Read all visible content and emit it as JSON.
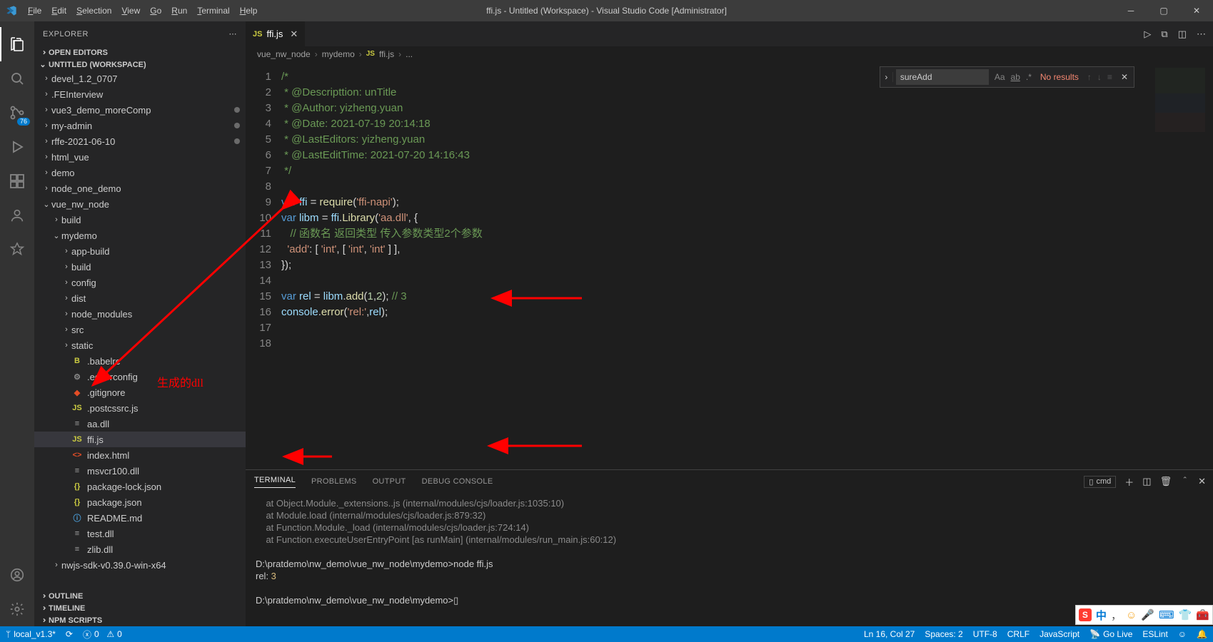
{
  "window": {
    "title": "ffi.js - Untitled (Workspace) - Visual Studio Code [Administrator]"
  },
  "menu": {
    "items": [
      "File",
      "Edit",
      "Selection",
      "View",
      "Go",
      "Run",
      "Terminal",
      "Help"
    ]
  },
  "activitybar": {
    "badge_scm": "76"
  },
  "sidebar": {
    "title": "EXPLORER",
    "sections": {
      "open_editors": "OPEN EDITORS",
      "workspace": "UNTITLED (WORKSPACE)",
      "outline": "OUTLINE",
      "timeline": "TIMELINE",
      "npm": "NPM SCRIPTS"
    },
    "tree": [
      {
        "depth": 0,
        "kind": "folder",
        "open": false,
        "name": "devel_1.2_0707",
        "dot": false
      },
      {
        "depth": 0,
        "kind": "folder",
        "open": false,
        "name": ".FEInterview",
        "dot": false
      },
      {
        "depth": 0,
        "kind": "folder",
        "open": false,
        "name": "vue3_demo_moreComp",
        "dot": true
      },
      {
        "depth": 0,
        "kind": "folder",
        "open": false,
        "name": "my-admin",
        "dot": true
      },
      {
        "depth": 0,
        "kind": "folder",
        "open": false,
        "name": "rffe-2021-06-10",
        "dot": true
      },
      {
        "depth": 0,
        "kind": "folder",
        "open": false,
        "name": "html_vue",
        "dot": false
      },
      {
        "depth": 0,
        "kind": "folder",
        "open": false,
        "name": "demo",
        "dot": false
      },
      {
        "depth": 0,
        "kind": "folder",
        "open": false,
        "name": "node_one_demo",
        "dot": false
      },
      {
        "depth": 0,
        "kind": "folder",
        "open": true,
        "name": "vue_nw_node",
        "dot": false
      },
      {
        "depth": 1,
        "kind": "folder",
        "open": false,
        "name": "build",
        "dot": false
      },
      {
        "depth": 1,
        "kind": "folder",
        "open": true,
        "name": "mydemo",
        "dot": false
      },
      {
        "depth": 2,
        "kind": "folder",
        "open": false,
        "name": "app-build",
        "dot": false
      },
      {
        "depth": 2,
        "kind": "folder",
        "open": false,
        "name": "build",
        "dot": false
      },
      {
        "depth": 2,
        "kind": "folder",
        "open": false,
        "name": "config",
        "dot": false
      },
      {
        "depth": 2,
        "kind": "folder",
        "open": false,
        "name": "dist",
        "dot": false
      },
      {
        "depth": 2,
        "kind": "folder",
        "open": false,
        "name": "node_modules",
        "dot": false
      },
      {
        "depth": 2,
        "kind": "folder",
        "open": false,
        "name": "src",
        "dot": false
      },
      {
        "depth": 2,
        "kind": "folder",
        "open": false,
        "name": "static",
        "dot": false
      },
      {
        "depth": 2,
        "kind": "file",
        "icon": "babel",
        "name": ".babelrc"
      },
      {
        "depth": 2,
        "kind": "file",
        "icon": "gear",
        "name": ".editorconfig"
      },
      {
        "depth": 2,
        "kind": "file",
        "icon": "git",
        "name": ".gitignore"
      },
      {
        "depth": 2,
        "kind": "file",
        "icon": "js",
        "name": ".postcssrc.js"
      },
      {
        "depth": 2,
        "kind": "file",
        "icon": "bin",
        "name": "aa.dll"
      },
      {
        "depth": 2,
        "kind": "file",
        "icon": "js",
        "name": "ffi.js",
        "sel": true
      },
      {
        "depth": 2,
        "kind": "file",
        "icon": "html",
        "name": "index.html"
      },
      {
        "depth": 2,
        "kind": "file",
        "icon": "bin",
        "name": "msvcr100.dll"
      },
      {
        "depth": 2,
        "kind": "file",
        "icon": "json",
        "name": "package-lock.json"
      },
      {
        "depth": 2,
        "kind": "file",
        "icon": "json",
        "name": "package.json"
      },
      {
        "depth": 2,
        "kind": "file",
        "icon": "info",
        "name": "README.md"
      },
      {
        "depth": 2,
        "kind": "file",
        "icon": "bin",
        "name": "test.dll"
      },
      {
        "depth": 2,
        "kind": "file",
        "icon": "bin",
        "name": "zlib.dll"
      },
      {
        "depth": 1,
        "kind": "folder",
        "open": false,
        "name": "nwjs-sdk-v0.39.0-win-x64",
        "dot": false
      }
    ]
  },
  "tabs": {
    "active": "ffi.js"
  },
  "breadcrumbs": [
    "vue_nw_node",
    "mydemo",
    "ffi.js",
    "..."
  ],
  "find": {
    "value": "sureAdd",
    "result": "No results"
  },
  "code": {
    "lines": [
      {
        "n": 1,
        "html": "<span class='c-cmt'>/*</span>"
      },
      {
        "n": 2,
        "html": "<span class='c-cmt'> * @Descripttion: unTitle</span>"
      },
      {
        "n": 3,
        "html": "<span class='c-cmt'> * @Author: yizheng.yuan</span>"
      },
      {
        "n": 4,
        "html": "<span class='c-cmt'> * @Date: 2021-07-19 20:14:18</span>"
      },
      {
        "n": 5,
        "html": "<span class='c-cmt'> * @LastEditors: yizheng.yuan</span>"
      },
      {
        "n": 6,
        "html": "<span class='c-cmt'> * @LastEditTime: 2021-07-20 14:16:43</span>"
      },
      {
        "n": 7,
        "html": "<span class='c-cmt'> */</span>"
      },
      {
        "n": 8,
        "html": ""
      },
      {
        "n": 9,
        "html": "<span class='c-key'>var</span> <span class='c-var'>ffi</span> = <span class='c-fn'>require</span>(<span class='c-str'>'ffi-napi'</span>);"
      },
      {
        "n": 10,
        "html": "<span class='c-key'>var</span> <span class='c-var'>libm</span> = <span class='c-var'>ffi</span>.<span class='c-fn'>Library</span>(<span class='c-str'>'aa.dll'</span>, {"
      },
      {
        "n": 11,
        "html": "   <span class='c-cmt'>// 函数名 返回类型 传入参数类型2个参数</span>"
      },
      {
        "n": 12,
        "html": "  <span class='c-str'>'add'</span>: [ <span class='c-str'>'int'</span>, [ <span class='c-str'>'int'</span>, <span class='c-str'>'int'</span> ] ],"
      },
      {
        "n": 13,
        "html": "});"
      },
      {
        "n": 14,
        "html": ""
      },
      {
        "n": 15,
        "html": "<span class='c-key'>var</span> <span class='c-var'>rel</span> = <span class='c-var'>libm</span>.<span class='c-fn'>add</span>(<span class='c-num'>1</span>,<span class='c-num'>2</span>); <span class='c-cmt'>// 3</span>"
      },
      {
        "n": 16,
        "html": "<span class='c-var'>console</span>.<span class='c-fn'>error</span>(<span class='c-str'>'rel:'</span>,<span class='c-var'>rel</span>);"
      },
      {
        "n": 17,
        "html": ""
      },
      {
        "n": 18,
        "html": ""
      }
    ]
  },
  "panel": {
    "tabs": [
      "TERMINAL",
      "PROBLEMS",
      "OUTPUT",
      "DEBUG CONSOLE"
    ],
    "shell": "cmd",
    "terminal": [
      {
        "cls": "dim",
        "t": "    at Object.Module._extensions..js (internal/modules/cjs/loader.js:1035:10)"
      },
      {
        "cls": "dim",
        "t": "    at Module.load (internal/modules/cjs/loader.js:879:32)"
      },
      {
        "cls": "dim",
        "t": "    at Function.Module._load (internal/modules/cjs/loader.js:724:14)"
      },
      {
        "cls": "dim",
        "t": "    at Function.executeUserEntryPoint [as runMain] (internal/modules/run_main.js:60:12)"
      },
      {
        "cls": "",
        "t": ""
      },
      {
        "cls": "",
        "t": "D:\\pratdemo\\nw_demo\\vue_nw_node\\mydemo>node ffi.js"
      },
      {
        "cls": "",
        "html": "rel: <span class='y'>3</span>"
      },
      {
        "cls": "",
        "t": ""
      },
      {
        "cls": "",
        "t": "D:\\pratdemo\\nw_demo\\vue_nw_node\\mydemo>▯"
      }
    ]
  },
  "status": {
    "left": {
      "branch": "local_v1.3*",
      "sync": "",
      "errors": "0",
      "warnings": "0"
    },
    "right": {
      "pos": "Ln 16, Col 27",
      "spaces": "Spaces: 2",
      "enc": "UTF-8",
      "eol": "CRLF",
      "lang": "JavaScript",
      "golive": "Go Live",
      "eslint": "ESLint"
    }
  },
  "annotation": {
    "dll_label": "生成的dll"
  },
  "ime": {
    "mode": "中"
  }
}
